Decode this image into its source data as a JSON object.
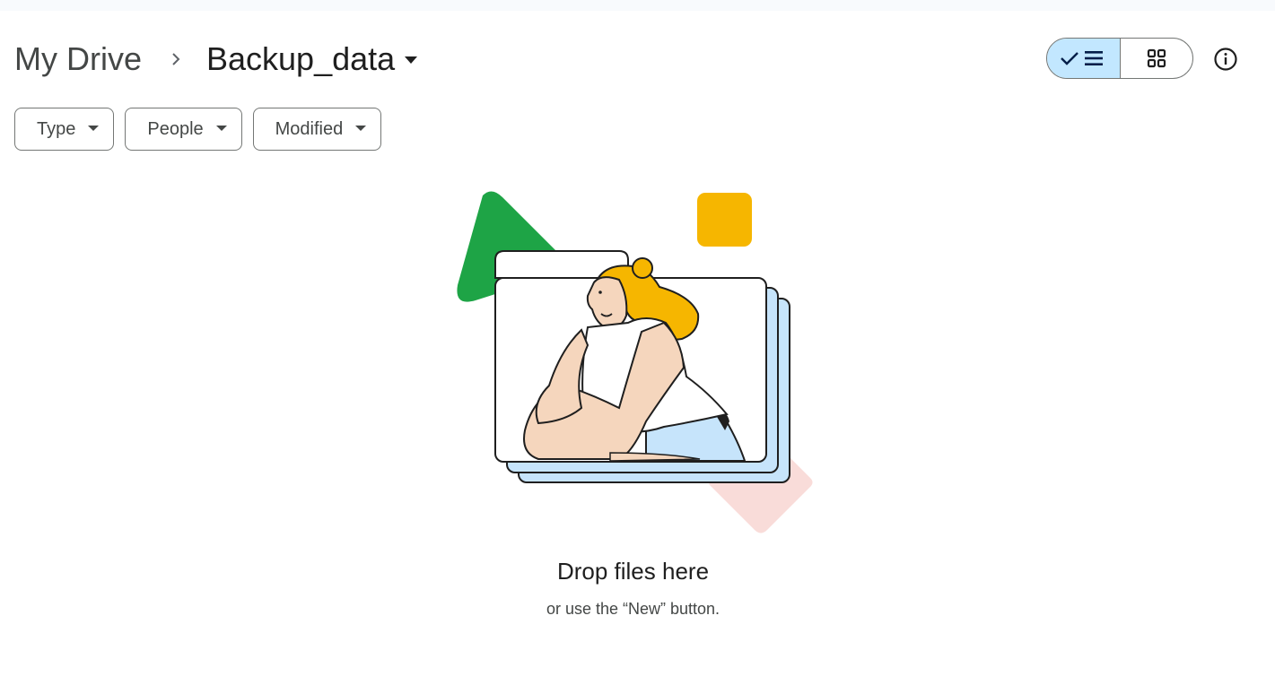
{
  "breadcrumb": {
    "root": "My Drive",
    "current": "Backup_data"
  },
  "view_toggle": {
    "selected": "list",
    "list_icon": "check-list-icon",
    "grid_icon": "grid-icon"
  },
  "info_icon": "info-icon",
  "filters": [
    {
      "label": "Type"
    },
    {
      "label": "People"
    },
    {
      "label": "Modified"
    }
  ],
  "empty_state": {
    "title": "Drop files here",
    "subtitle": "or use the “New” button."
  },
  "colors": {
    "selected_toggle": "#c2e7ff",
    "green": "#1ea446",
    "yellow": "#f6b600",
    "pink": "#f9dcd9",
    "blue": "#c6e4fb",
    "skin": "#f5d6bd"
  }
}
